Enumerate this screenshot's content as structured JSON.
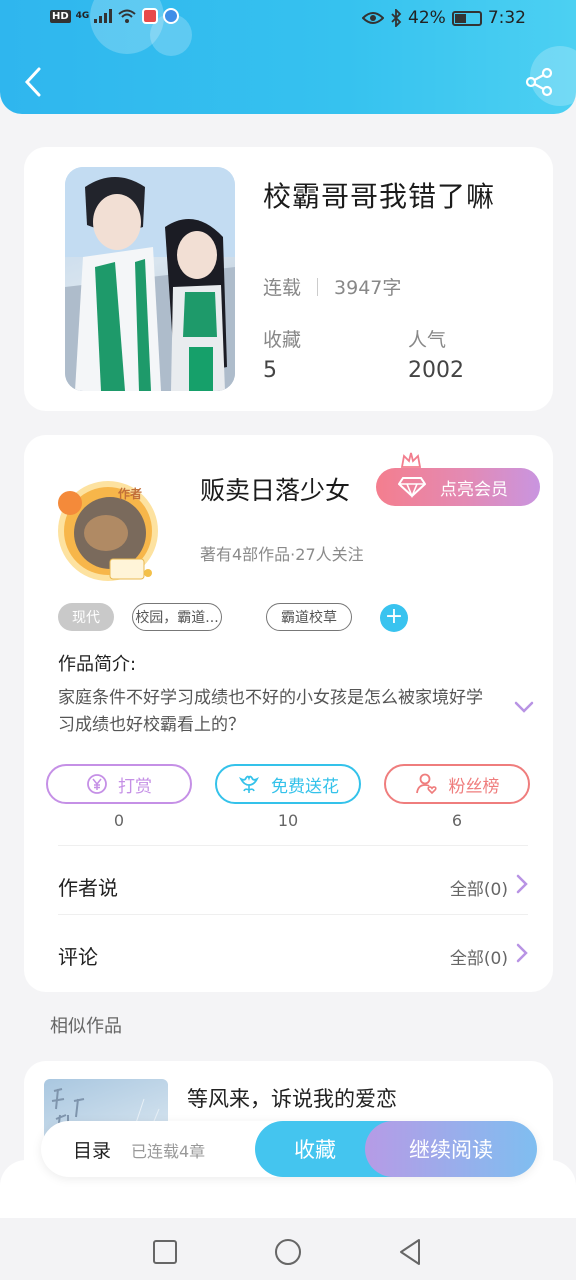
{
  "status_bar": {
    "network": "HD",
    "signal": "4G",
    "battery": "42%",
    "time": "7:32"
  },
  "book": {
    "title": "校霸哥哥我错了嘛",
    "status": "连载",
    "word_count": "3947字",
    "favorites_label": "收藏",
    "favorites_value": "5",
    "popularity_label": "人气",
    "popularity_value": "2002"
  },
  "author": {
    "avatar_badge": "作者",
    "name": "贩卖日落少女",
    "vip_button": "点亮会员",
    "stats": "著有4部作品·27人关注",
    "tags": [
      "现代",
      "校园，霸道...",
      "霸道校草"
    ],
    "intro_label": "作品简介:",
    "intro_text": "家庭条件不好学习成绩也不好的小女孩是怎么被家境好学习成绩也好校霸看上的？"
  },
  "actions": [
    {
      "label": "打赏",
      "count": "0",
      "color": "#c590e6"
    },
    {
      "label": "免费送花",
      "count": "10",
      "color": "#34c2ea"
    },
    {
      "label": "粉丝榜",
      "count": "6",
      "color": "#ef7d7d"
    }
  ],
  "links": {
    "author_says": {
      "label": "作者说",
      "value": "全部(0)"
    },
    "comments": {
      "label": "评论",
      "value": "全部(0)"
    }
  },
  "similar": {
    "label": "相似作品",
    "items": [
      {
        "title": "等风来，诉说我的爱恋"
      }
    ]
  },
  "bottom_bar": {
    "toc": "目录",
    "serial": "已连载4章",
    "collect": "收藏",
    "continue": "继续阅读"
  },
  "colors": {
    "header": "#36c2ef",
    "accent": "#c995e0",
    "plus": "#39c3ef"
  }
}
